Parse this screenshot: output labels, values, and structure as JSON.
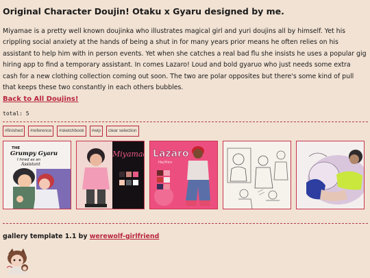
{
  "title": "Original Character Doujin! Otaku x Gyaru designed by me.",
  "description": "Miyamae is a pretty well known doujinka who illustrates magical girl and yuri doujins all by himself. Yet his crippling social anxiety at the hands of being a shut in for many years prior means he often relies on his assistant to help him with in person events. Yet when she catches a real bad flu she insists he uses a popular gig hiring app to find a temporary assistant. In comes Lazaro! Loud and bold gyaruo who just needs some extra cash for a new clothing collection coming out soon. The two are polar opposites but there's some kind of pull that keeps these two constantly in each others bubbles.",
  "back_link": "Back to All Doujins!",
  "total": "total: 5",
  "filters": [
    "#finished",
    "#reference",
    "#sketchbook",
    "#wip",
    "clear selection"
  ],
  "gallery": [
    {
      "name": "cover-art",
      "caption": "THE Grumpy Gyaru I hired as an Assistant"
    },
    {
      "name": "miyamae-reference",
      "caption": "Miyamae"
    },
    {
      "name": "lazaro-reference",
      "caption": "Lazaro He/Him"
    },
    {
      "name": "sketch-page",
      "caption": ""
    },
    {
      "name": "colored-sketch",
      "caption": ""
    }
  ],
  "footer": {
    "text": "gallery template 1.1 by ",
    "link": "werewolf-girlfriend"
  },
  "colors": {
    "background": "#f1e2d3",
    "accent": "#b8243c",
    "border": "#c7354c"
  }
}
